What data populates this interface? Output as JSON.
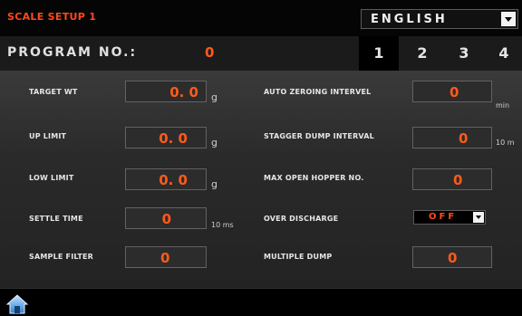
{
  "header": {
    "title": "SCALE SETUP 1",
    "language": "ENGLISH"
  },
  "program": {
    "label": "PROGRAM NO.:",
    "value": "0",
    "tabs": [
      "1",
      "2",
      "3",
      "4"
    ],
    "active_tab": "1"
  },
  "left_fields": [
    {
      "label": "TARGET WT",
      "value": "0. 0",
      "unit": "g"
    },
    {
      "label": "UP LIMIT",
      "value": "0. 0",
      "unit": "g"
    },
    {
      "label": "LOW LIMIT",
      "value": "0. 0",
      "unit": "g"
    },
    {
      "label": "SETTLE TIME",
      "value": "0",
      "unit": "10 ms"
    },
    {
      "label": "SAMPLE FILTER",
      "value": "0",
      "unit": ""
    }
  ],
  "right_fields": [
    {
      "label": "AUTO ZEROING INTERVEL",
      "value": "0",
      "unit": "min"
    },
    {
      "label": "STAGGER DUMP INTERVAL",
      "value": "0",
      "unit": "10 m"
    },
    {
      "label": "MAX OPEN HOPPER NO.",
      "value": "0",
      "unit": ""
    },
    {
      "label": "OVER DISCHARGE",
      "value": "OFF",
      "unit": ""
    },
    {
      "label": "MULTIPLE DUMP",
      "value": "0",
      "unit": ""
    }
  ],
  "colors": {
    "accent": "#ff5a1a",
    "panel": "#2e2e2e"
  },
  "icons": {
    "home": "home-icon",
    "dropdown": "chevron-down-icon"
  }
}
